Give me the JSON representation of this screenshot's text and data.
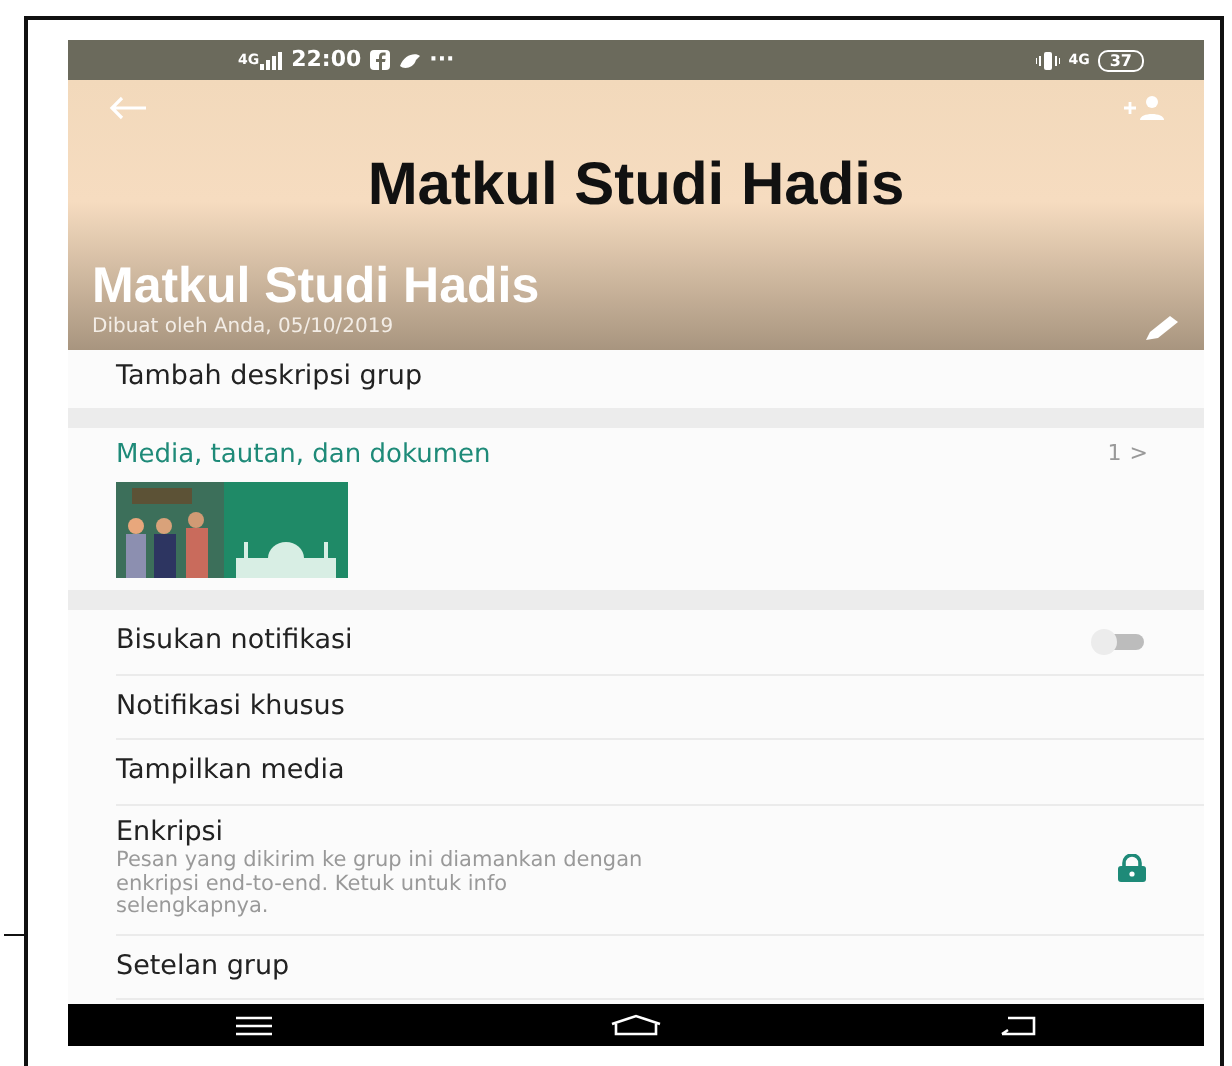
{
  "status_bar": {
    "network": "4G",
    "time": "22:00",
    "more": "···",
    "network_right": "4G",
    "battery": "37"
  },
  "header": {
    "banner_title": "Matkul Studi Hadis",
    "group_name": "Matkul Studi Hadis",
    "created": "Dibuat oleh Anda, 05/10/2019"
  },
  "description_prompt": "Tambah deskripsi grup",
  "media": {
    "label": "Media, tautan, dan dokumen",
    "count": "1",
    "chevron": ">"
  },
  "settings": [
    {
      "kind": "toggle",
      "label": "Bisukan notifikasi",
      "on": false
    },
    {
      "kind": "plain",
      "label": "Notifikasi khusus"
    },
    {
      "kind": "plain",
      "label": "Tampilkan media"
    },
    {
      "kind": "lock",
      "label": "Enkripsi",
      "description": "Pesan yang dikirim ke grup ini diamankan dengan enkripsi end-to-end. Ketuk untuk info selengkapnya."
    },
    {
      "kind": "plain",
      "label": "Setelan grup"
    }
  ]
}
